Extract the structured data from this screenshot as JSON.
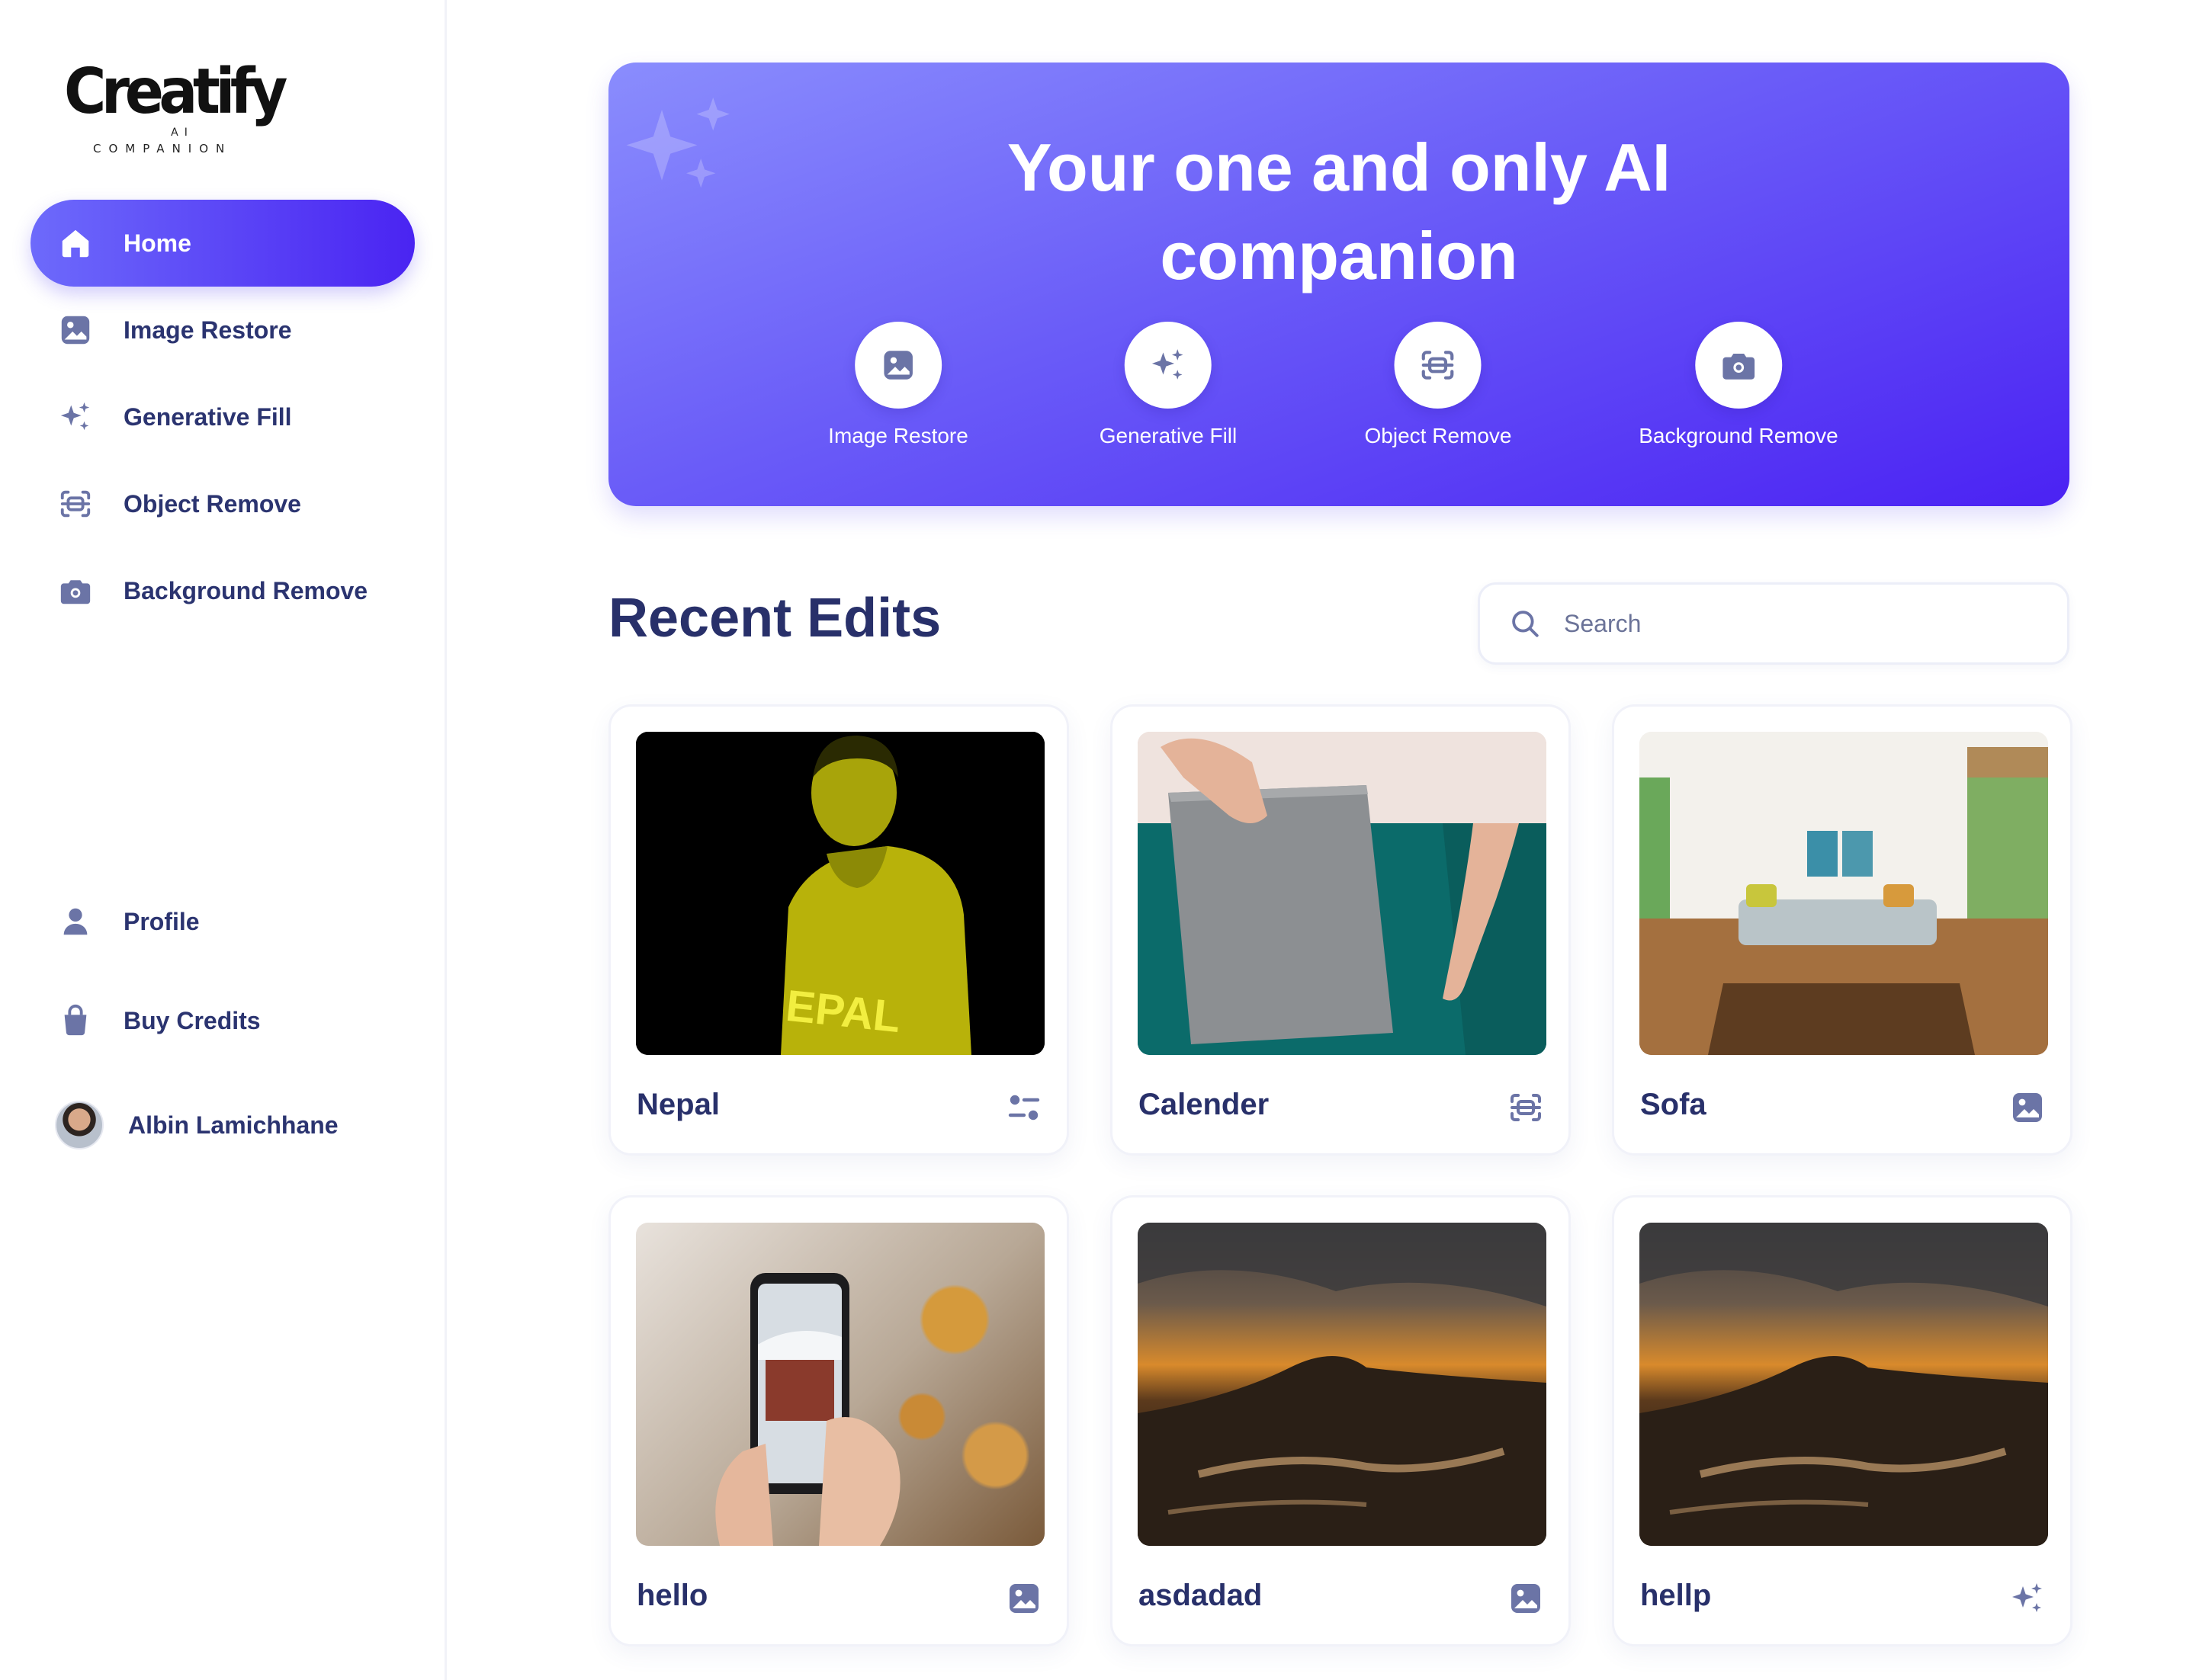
{
  "brand": {
    "logo_text": "Creatify",
    "logo_ai": "AI",
    "logo_sub": "COMPANION"
  },
  "sidebar": {
    "items": [
      {
        "label": "Home",
        "icon": "home-icon",
        "active": true
      },
      {
        "label": "Image Restore",
        "icon": "image-icon",
        "active": false
      },
      {
        "label": "Generative Fill",
        "icon": "sparkle-icon",
        "active": false
      },
      {
        "label": "Object Remove",
        "icon": "scan-icon",
        "active": false
      },
      {
        "label": "Background Remove",
        "icon": "camera-icon",
        "active": false
      }
    ],
    "bottom_items": [
      {
        "label": "Profile",
        "icon": "user-icon"
      },
      {
        "label": "Buy Credits",
        "icon": "bag-icon"
      }
    ],
    "user_name": "Albin Lamichhane"
  },
  "hero": {
    "title": "Your one and only AI\ncompanion",
    "tools": [
      {
        "label": "Image Restore",
        "icon": "image-icon"
      },
      {
        "label": "Generative Fill",
        "icon": "sparkle-icon"
      },
      {
        "label": "Object Remove",
        "icon": "scan-icon"
      },
      {
        "label": "Background Remove",
        "icon": "camera-icon"
      }
    ]
  },
  "recent": {
    "title": "Recent Edits",
    "search_placeholder": "Search",
    "cards": [
      {
        "title": "Nepal",
        "icon": "adjust-icon"
      },
      {
        "title": "Calender",
        "icon": "scan-icon"
      },
      {
        "title": "Sofa",
        "icon": "image-icon"
      },
      {
        "title": "hello",
        "icon": "image-icon"
      },
      {
        "title": "asdadad",
        "icon": "image-icon"
      },
      {
        "title": "hellp",
        "icon": "sparkle-icon"
      }
    ]
  },
  "colors": {
    "accent": "#4a24f2",
    "accent_light": "#8a8dfd",
    "text": "#2b3470",
    "icon": "#6b74a6"
  }
}
